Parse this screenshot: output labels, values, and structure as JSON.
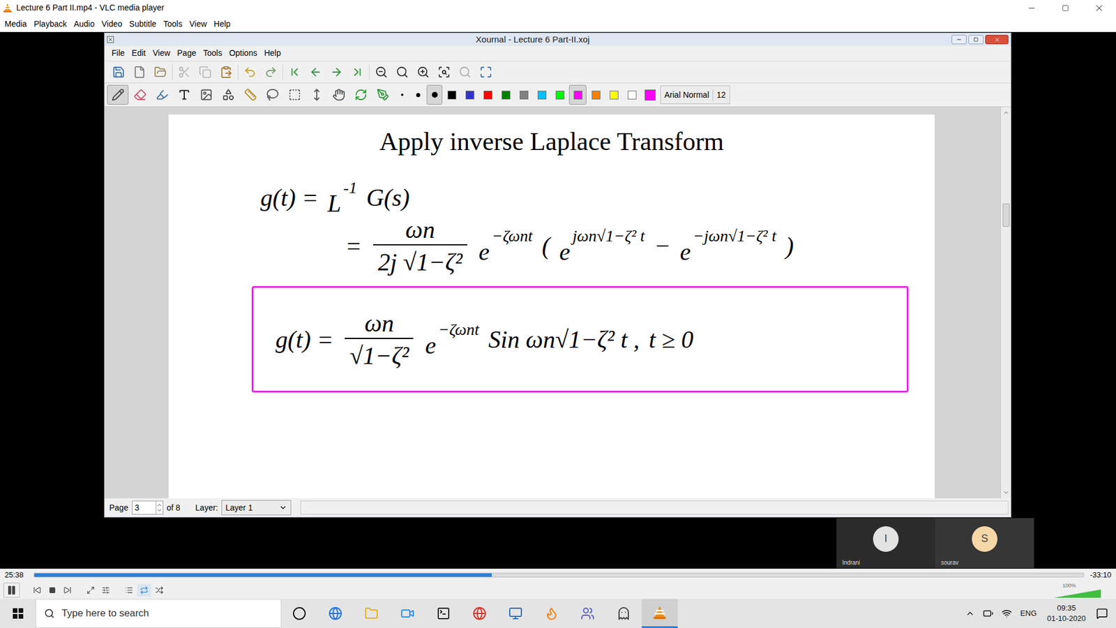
{
  "window": {
    "title": "Lecture 6 Part II.mp4 - VLC media player"
  },
  "menu": [
    "Media",
    "Playback",
    "Audio",
    "Video",
    "Subtitle",
    "Tools",
    "View",
    "Help"
  ],
  "xournal": {
    "title": "Xournal - Lecture 6 Part-II.xoj",
    "menu": [
      "File",
      "Edit",
      "View",
      "Page",
      "Tools",
      "Options",
      "Help"
    ],
    "toolbar": [
      {
        "disabled": false
      },
      {
        "disabled": false
      },
      {
        "disabled": false
      },
      {
        "disabled": true
      },
      {
        "disabled": true
      },
      {
        "disabled": false
      },
      {
        "disabled": false
      },
      {
        "disabled": false
      },
      {
        "disabled": false
      },
      {
        "disabled": false
      },
      {
        "disabled": false
      },
      {
        "disabled": false
      },
      {
        "disabled": false
      },
      {
        "disabled": false
      },
      {
        "disabled": false
      },
      {
        "disabled": false
      },
      {
        "disabled": true
      },
      {
        "disabled": false
      }
    ],
    "tools": [
      {
        "selected": true
      },
      {
        "selected": false
      },
      {
        "selected": false
      },
      {
        "selected": false
      },
      {
        "selected": false
      },
      {
        "selected": false
      },
      {
        "selected": false
      },
      {
        "selected": false
      },
      {
        "selected": false
      },
      {
        "selected": false
      },
      {
        "selected": false
      },
      {
        "selected": false
      },
      {
        "selected": false
      }
    ],
    "sizes": [
      {
        "selected": false
      },
      {
        "selected": false
      },
      {
        "selected": true
      }
    ],
    "colors": [
      {
        "color": "#000000",
        "selected": false
      },
      {
        "color": "#3333cc",
        "selected": false
      },
      {
        "color": "#ff0000",
        "selected": false
      },
      {
        "color": "#008000",
        "selected": false
      },
      {
        "color": "#808080",
        "selected": false
      },
      {
        "color": "#00c0ff",
        "selected": false
      },
      {
        "color": "#00ff00",
        "selected": false
      },
      {
        "color": "#ff00ff",
        "selected": true
      },
      {
        "color": "#ff8000",
        "selected": false
      },
      {
        "color": "#ffff00",
        "selected": false
      },
      {
        "color": "#ffffff",
        "selected": false
      }
    ],
    "current_color": "#ff00ff",
    "font": "Arial Normal",
    "font_size": "12",
    "page": {
      "heading": "Apply inverse Laplace Transform",
      "equations": [
        {
          "boxed": false,
          "box_color": "#ff00ff",
          "tokens": [
            {
              "kind": "text",
              "text": "g(t) ="
            },
            {
              "kind": "sup",
              "base": "L",
              "sup": "-1"
            },
            {
              "kind": "text",
              "text": "G(s)"
            }
          ]
        },
        {
          "boxed": false,
          "box_color": "#ff00ff",
          "tokens": [
            {
              "kind": "text",
              "text": "="
            },
            {
              "kind": "frac",
              "num": "ωn",
              "den": "2j √1−ζ²"
            },
            {
              "kind": "sup",
              "base": "e",
              "sup": "−ζωnt"
            },
            {
              "kind": "text",
              "text": "("
            },
            {
              "kind": "sup",
              "base": "e",
              "sup": "jωn√1−ζ² t"
            },
            {
              "kind": "text",
              "text": "−"
            },
            {
              "kind": "sup",
              "base": "e",
              "sup": "−jωn√1−ζ² t"
            },
            {
              "kind": "text",
              "text": ")"
            }
          ]
        },
        {
          "boxed": true,
          "box_color": "#ee22e6",
          "tokens": [
            {
              "kind": "text",
              "text": "g(t) ="
            },
            {
              "kind": "frac",
              "num": "ωn",
              "den": "√1−ζ²"
            },
            {
              "kind": "sup",
              "base": "e",
              "sup": "−ζωnt"
            },
            {
              "kind": "text",
              "text": "Sin ωn√1−ζ² t ,"
            },
            {
              "kind": "text",
              "text": "t ≥ 0"
            }
          ]
        }
      ]
    },
    "status": {
      "page_label": "Page",
      "page": "3",
      "of": "of 8",
      "layer_label": "Layer:",
      "layer": "Layer 1"
    }
  },
  "participants": [
    {
      "initial": "I",
      "name": "Indrani",
      "color": "#e3e3e3"
    },
    {
      "initial": "S",
      "name": "sourav",
      "color": "#f6d7a7"
    }
  ],
  "player": {
    "elapsed": "25:38",
    "remaining": "-33:10",
    "level": 0.436,
    "playing": true,
    "volume": "100%",
    "volume_level": 1
  },
  "taskbar": {
    "search": "Type here to search",
    "language": "ENG",
    "time": "09:35",
    "date": "01-10-2020"
  }
}
